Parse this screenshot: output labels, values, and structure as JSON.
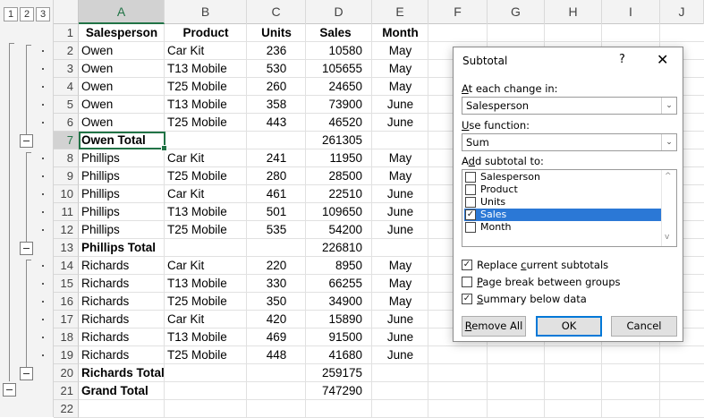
{
  "outline_levels": [
    "1",
    "2",
    "3"
  ],
  "columns": [
    "A",
    "B",
    "C",
    "D",
    "E",
    "F",
    "G",
    "H",
    "I",
    "J"
  ],
  "rows": [
    {
      "n": "1",
      "a": "Salesperson",
      "b": "Product",
      "c": "Units",
      "d": "Sales",
      "e": "Month",
      "header": true
    },
    {
      "n": "2",
      "a": "Owen",
      "b": "Car Kit",
      "c": "236",
      "d": "10580",
      "e": "May"
    },
    {
      "n": "3",
      "a": "Owen",
      "b": "T13 Mobile",
      "c": "530",
      "d": "105655",
      "e": "May"
    },
    {
      "n": "4",
      "a": "Owen",
      "b": "T25 Mobile",
      "c": "260",
      "d": "24650",
      "e": "May"
    },
    {
      "n": "5",
      "a": "Owen",
      "b": "T13 Mobile",
      "c": "358",
      "d": "73900",
      "e": "June"
    },
    {
      "n": "6",
      "a": "Owen",
      "b": "T25 Mobile",
      "c": "443",
      "d": "46520",
      "e": "June"
    },
    {
      "n": "7",
      "a": "Owen Total",
      "b": "",
      "c": "",
      "d": "261305",
      "e": "",
      "total": true
    },
    {
      "n": "8",
      "a": "Phillips",
      "b": "Car Kit",
      "c": "241",
      "d": "11950",
      "e": "May"
    },
    {
      "n": "9",
      "a": "Phillips",
      "b": "T25 Mobile",
      "c": "280",
      "d": "28500",
      "e": "May"
    },
    {
      "n": "10",
      "a": "Phillips",
      "b": "Car Kit",
      "c": "461",
      "d": "22510",
      "e": "June"
    },
    {
      "n": "11",
      "a": "Phillips",
      "b": "T13 Mobile",
      "c": "501",
      "d": "109650",
      "e": "June"
    },
    {
      "n": "12",
      "a": "Phillips",
      "b": "T25 Mobile",
      "c": "535",
      "d": "54200",
      "e": "June"
    },
    {
      "n": "13",
      "a": "Phillips Total",
      "b": "",
      "c": "",
      "d": "226810",
      "e": "",
      "total": true
    },
    {
      "n": "14",
      "a": "Richards",
      "b": "Car Kit",
      "c": "220",
      "d": "8950",
      "e": "May"
    },
    {
      "n": "15",
      "a": "Richards",
      "b": "T13 Mobile",
      "c": "330",
      "d": "66255",
      "e": "May"
    },
    {
      "n": "16",
      "a": "Richards",
      "b": "T25 Mobile",
      "c": "350",
      "d": "34900",
      "e": "May"
    },
    {
      "n": "17",
      "a": "Richards",
      "b": "Car Kit",
      "c": "420",
      "d": "15890",
      "e": "June"
    },
    {
      "n": "18",
      "a": "Richards",
      "b": "T13 Mobile",
      "c": "469",
      "d": "91500",
      "e": "June"
    },
    {
      "n": "19",
      "a": "Richards",
      "b": "T25 Mobile",
      "c": "448",
      "d": "41680",
      "e": "June"
    },
    {
      "n": "20",
      "a": "Richards Total",
      "b": "",
      "c": "",
      "d": "259175",
      "e": "",
      "total": true
    },
    {
      "n": "21",
      "a": "Grand Total",
      "b": "",
      "c": "",
      "d": "747290",
      "e": "",
      "total": true
    },
    {
      "n": "22",
      "a": "",
      "b": "",
      "c": "",
      "d": "",
      "e": ""
    }
  ],
  "dialog": {
    "title": "Subtotal",
    "help": "?",
    "close": "✕",
    "change_label_pre": "",
    "change_label_u": "A",
    "change_label_post": "t each change in:",
    "change_value": "Salesperson",
    "function_label_pre": "",
    "function_label_u": "U",
    "function_label_post": "se function:",
    "function_value": "Sum",
    "add_label_pre": "A",
    "add_label_u": "d",
    "add_label_post": "d subtotal to:",
    "fields": [
      {
        "label": "Salesperson",
        "checked": false
      },
      {
        "label": "Product",
        "checked": false
      },
      {
        "label": "Units",
        "checked": false
      },
      {
        "label": "Sales",
        "checked": true,
        "selected": true
      },
      {
        "label": "Month",
        "checked": false
      }
    ],
    "options": [
      {
        "pre": "Replace ",
        "u": "c",
        "post": "urrent subtotals",
        "checked": true
      },
      {
        "pre": "",
        "u": "P",
        "post": "age break between groups",
        "checked": false
      },
      {
        "pre": "",
        "u": "S",
        "post": "ummary below data",
        "checked": true
      }
    ],
    "remove_all_pre": "",
    "remove_all_u": "R",
    "remove_all_post": "emove All",
    "ok": "OK",
    "cancel": "Cancel",
    "check_glyph": "✓",
    "arrow_glyph": "⌄",
    "scroll_up": "^",
    "scroll_down": "v"
  },
  "accent_color": "#217346",
  "selection_color": "#2b78d6"
}
